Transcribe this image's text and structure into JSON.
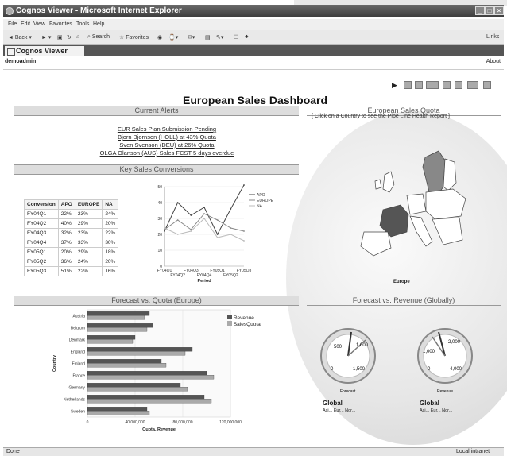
{
  "window": {
    "title": "Cognos Viewer - Microsoft Internet Explorer"
  },
  "menu": [
    "File",
    "Edit",
    "View",
    "Favorites",
    "Tools",
    "Help"
  ],
  "toolbar": {
    "back": "Back",
    "search": "Search",
    "favorites": "Favorites",
    "links": "Links"
  },
  "tab": {
    "label": "Cognos Viewer"
  },
  "user": {
    "name": "demoadmin",
    "about": "About"
  },
  "dashboard": {
    "title": "European Sales Dashboard"
  },
  "sections": {
    "alerts_title": "Current Alerts",
    "quota_title": "European Sales Quota",
    "quota_note": "[ Click on a Country to see the Pipe Line Health Report ]",
    "conversions_title": "Key Sales Conversions",
    "forecast_quota_title": "Forecast vs. Quota (Europe)",
    "forecast_revenue_title": "Forecast vs. Revenue (Globally)"
  },
  "alerts": [
    "EUR Sales Plan Submission Pending",
    "Bjorn Bjornson (HOLL) at 43% Quota",
    "Sven Svenson (DEU) at 26% Quota",
    "OLGA Olanson (AUS) Sales FCST 5 days overdue"
  ],
  "conversion_table": {
    "headers": [
      "Conversion",
      "APO",
      "EUROPE",
      "NA"
    ],
    "rows": [
      [
        "FY04Q1",
        "22%",
        "23%",
        "24%"
      ],
      [
        "FY04Q2",
        "40%",
        "29%",
        "20%"
      ],
      [
        "FY04Q3",
        "32%",
        "23%",
        "22%"
      ],
      [
        "FY04Q4",
        "37%",
        "33%",
        "30%"
      ],
      [
        "FY05Q1",
        "20%",
        "29%",
        "18%"
      ],
      [
        "FY05Q2",
        "36%",
        "24%",
        "20%"
      ],
      [
        "FY05Q3",
        "51%",
        "22%",
        "16%"
      ]
    ]
  },
  "map_label": "Europe",
  "gauges": [
    {
      "ticks": [
        "500",
        "1,000",
        "1,500",
        "0"
      ],
      "label": "Forecast",
      "title": "Global",
      "legend": [
        "Asi...",
        "Eur...",
        "Nor..."
      ]
    },
    {
      "ticks": [
        "1,000",
        "2,000",
        "4,000",
        "0"
      ],
      "label": "Revenue",
      "title": "Global",
      "legend": [
        "Asi...",
        "Eur...",
        "Nor..."
      ]
    }
  ],
  "status": {
    "left": "Done",
    "right": "Local intranet"
  },
  "chart_data": [
    {
      "type": "line",
      "x": [
        "FY04Q1",
        "FY04Q2",
        "FY04Q3",
        "FY04Q4",
        "FY05Q1",
        "FY05Q2",
        "FY05Q3"
      ],
      "tick_rows": [
        [
          "FY04Q1",
          "FY04Q3",
          "FY05Q1",
          "FY05Q3"
        ],
        [
          "FY04Q2",
          "FY04Q4",
          "FY05Q2"
        ]
      ],
      "xlabel": "Period",
      "ylabel": "",
      "ylim": [
        0,
        50
      ],
      "yticks": [
        "50",
        "40",
        "30",
        "20",
        "10",
        "0"
      ],
      "series": [
        {
          "name": "APO",
          "values": [
            22,
            40,
            32,
            37,
            20,
            36,
            51
          ],
          "color": "#444444"
        },
        {
          "name": "EUROPE",
          "values": [
            23,
            29,
            23,
            33,
            29,
            24,
            22
          ],
          "color": "#888888"
        },
        {
          "name": "NA",
          "values": [
            24,
            20,
            22,
            30,
            18,
            20,
            16
          ],
          "color": "#bbbbbb"
        }
      ]
    },
    {
      "type": "bar",
      "orientation": "horizontal",
      "categories": [
        "Austria",
        "Belgium",
        "Denmark",
        "England",
        "Finland",
        "France",
        "Germany",
        "Netherlands",
        "Sweden"
      ],
      "xlabel": "Quota, Revenue",
      "ylabel": "Country",
      "xlim": [
        0,
        120000000
      ],
      "xticks": [
        "0",
        "40,000,000",
        "80,000,000",
        "120,000,000"
      ],
      "series": [
        {
          "name": "Revenue",
          "values": [
            52000000,
            55000000,
            40000000,
            88000000,
            62000000,
            100000000,
            78000000,
            98000000,
            50000000
          ],
          "color": "#555555"
        },
        {
          "name": "SalesQuota",
          "values": [
            48000000,
            50000000,
            38000000,
            82000000,
            66000000,
            106000000,
            84000000,
            104000000,
            52000000
          ],
          "color": "#aaaaaa"
        }
      ]
    }
  ]
}
